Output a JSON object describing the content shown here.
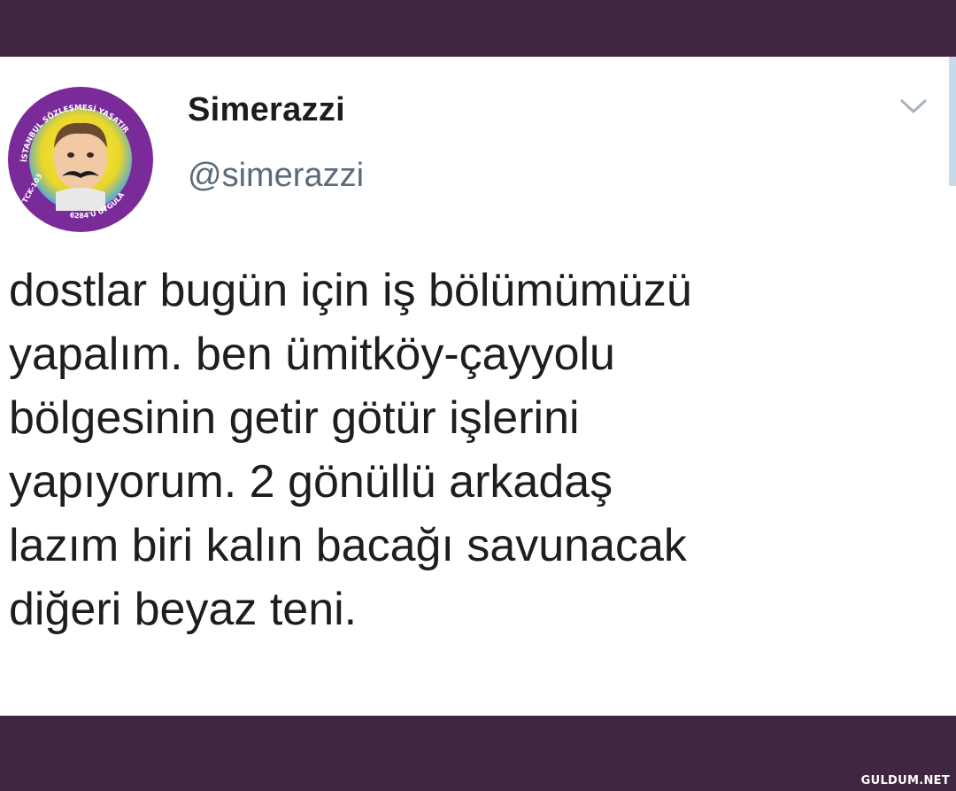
{
  "tweet": {
    "display_name": "Simerazzi",
    "handle": "@simerazzi",
    "avatar": {
      "badge_top": "İSTANBUL SÖZLEŞMESİ YAŞATIR",
      "badge_left": "TCK-103",
      "badge_bottom": "6284'Ü UYGULA",
      "ring_color": "#7a2b9a"
    },
    "text_lines": [
      "dostlar bugün için iş bölümümüzü",
      "yapalım. ben ümitköy-çayyolu",
      "bölgesinin getir götür işlerini",
      "yapıyorum. 2 gönüllü arkadaş",
      "lazım biri kalın bacağı savunacak",
      "diğeri beyaz teni."
    ],
    "menu_icon": "chevron-down-icon"
  },
  "watermark": "GULDUM.NET",
  "colors": {
    "frame": "#402640",
    "card": "#ffffff",
    "handle": "#5c6b79"
  }
}
